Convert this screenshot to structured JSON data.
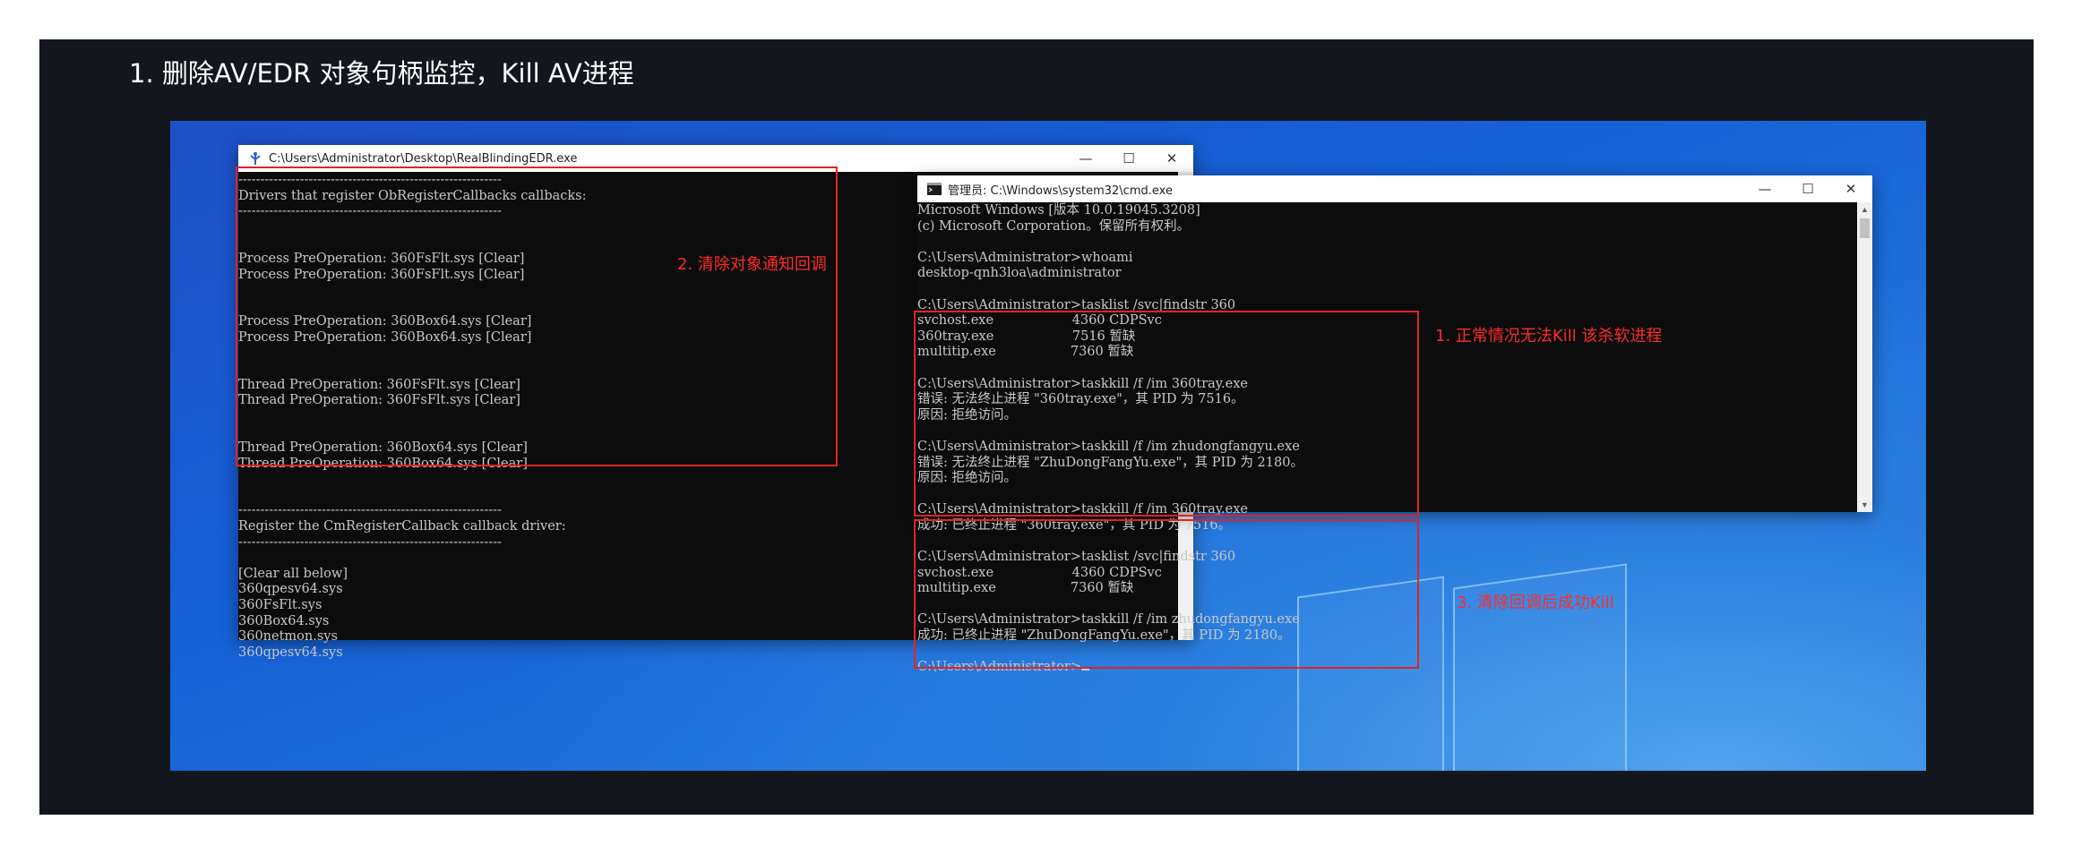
{
  "heading": "1.  删除AV/EDR 对象句柄监控，Kill AV进程",
  "window_left": {
    "title": "C:\\Users\\Administrator\\Desktop\\RealBlindingEDR.exe",
    "lines": [
      "------------------------------------------------------------",
      "Drivers that register ObRegisterCallbacks callbacks:",
      "------------------------------------------------------------",
      "",
      "",
      "Process PreOperation: 360FsFlt.sys [Clear]",
      "Process PreOperation: 360FsFlt.sys [Clear]",
      "",
      "",
      "Process PreOperation: 360Box64.sys [Clear]",
      "Process PreOperation: 360Box64.sys [Clear]",
      "",
      "",
      "Thread PreOperation: 360FsFlt.sys [Clear]",
      "Thread PreOperation: 360FsFlt.sys [Clear]",
      "",
      "",
      "Thread PreOperation: 360Box64.sys [Clear]",
      "Thread PreOperation: 360Box64.sys [Clear]",
      "",
      "",
      "------------------------------------------------------------",
      "Register the CmRegisterCallback callback driver:",
      "------------------------------------------------------------",
      "",
      "[Clear all below]",
      "360qpesv64.sys",
      "360FsFlt.sys",
      "360Box64.sys",
      "360netmon.sys",
      "360qpesv64.sys"
    ]
  },
  "window_right": {
    "title": "管理员: C:\\Windows\\system32\\cmd.exe",
    "lines": [
      "Microsoft Windows [版本 10.0.19045.3208]",
      "(c) Microsoft Corporation。保留所有权利。",
      "",
      "C:\\Users\\Administrator>whoami",
      "desktop-qnh3loa\\administrator",
      "",
      "C:\\Users\\Administrator>tasklist /svc|findstr 360",
      "svchost.exe                   4360 CDPSvc",
      "360tray.exe                   7516 暂缺",
      "multitip.exe                  7360 暂缺",
      "",
      "C:\\Users\\Administrator>taskkill /f /im 360tray.exe",
      "错误: 无法终止进程 \"360tray.exe\"，其 PID 为 7516。",
      "原因: 拒绝访问。",
      "",
      "C:\\Users\\Administrator>taskkill /f /im zhudongfangyu.exe",
      "错误: 无法终止进程 \"ZhuDongFangYu.exe\"，其 PID 为 2180。",
      "原因: 拒绝访问。",
      "",
      "C:\\Users\\Administrator>taskkill /f /im 360tray.exe",
      "成功: 已终止进程 \"360tray.exe\"，其 PID 为 7516。",
      "",
      "C:\\Users\\Administrator>tasklist /svc|findstr 360",
      "svchost.exe                   4360 CDPSvc",
      "multitip.exe                  7360 暂缺",
      "",
      "C:\\Users\\Administrator>taskkill /f /im zhudongfangyu.exe",
      "成功: 已终止进程 \"ZhuDongFangYu.exe\"，其 PID 为 2180。",
      "",
      "C:\\Users\\Administrator>"
    ]
  },
  "annotations": {
    "clear_callbacks": "2. 清除对象通知回调",
    "cannot_kill": "1. 正常情况无法Kill 该杀软进程",
    "kill_success": "3. 清除回调后成功Kill"
  },
  "window_controls": {
    "minimize": "—",
    "maximize": "☐",
    "close": "✕"
  },
  "colors": {
    "annotation_red": "#ff2b2b",
    "console_bg": "#0c0c0c",
    "console_text": "#c8c8c8"
  }
}
